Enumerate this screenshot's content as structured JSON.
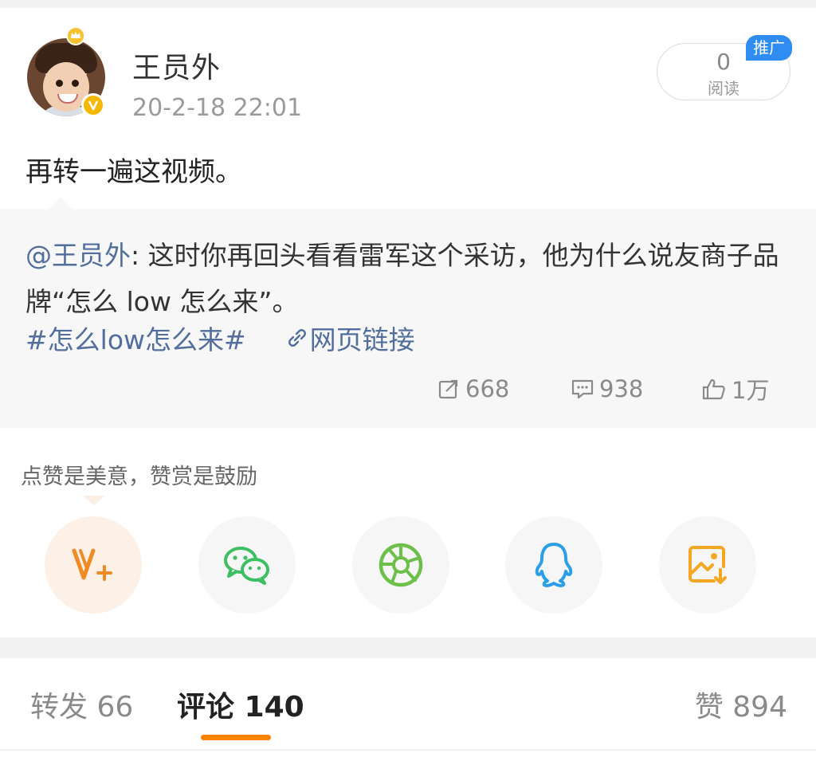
{
  "post": {
    "author": "王员外",
    "time": "20-2-18 22:01",
    "text": "再转一遍这视频。",
    "read_count": "0",
    "read_label": "阅读",
    "promo_label": "推广"
  },
  "quote": {
    "mention": "@王员外",
    "text": ": 这时你再回头看看雷军这个采访，他为什么说友商子品牌“怎么 low 怎么来”。",
    "topic": "#怎么low怎么来#",
    "link_label": "网页链接",
    "reposts": "668",
    "comments": "938",
    "likes": "1万"
  },
  "tip": {
    "text": "点赞是美意，赞赏是鼓励"
  },
  "share": {
    "icons": [
      "v-plus-icon",
      "wechat-icon",
      "moments-icon",
      "qq-icon",
      "save-image-icon"
    ],
    "colors": {
      "v": "#f08a24",
      "wechat": "#3dbf63",
      "moments": "#6cc04a",
      "qq": "#2a9ee8",
      "save": "#f5a623"
    }
  },
  "tabs": {
    "repost_label": "转发",
    "repost_count": "66",
    "comment_label": "评论",
    "comment_count": "140",
    "like_label": "赞",
    "like_count": "894"
  },
  "accent": "#ff8200"
}
